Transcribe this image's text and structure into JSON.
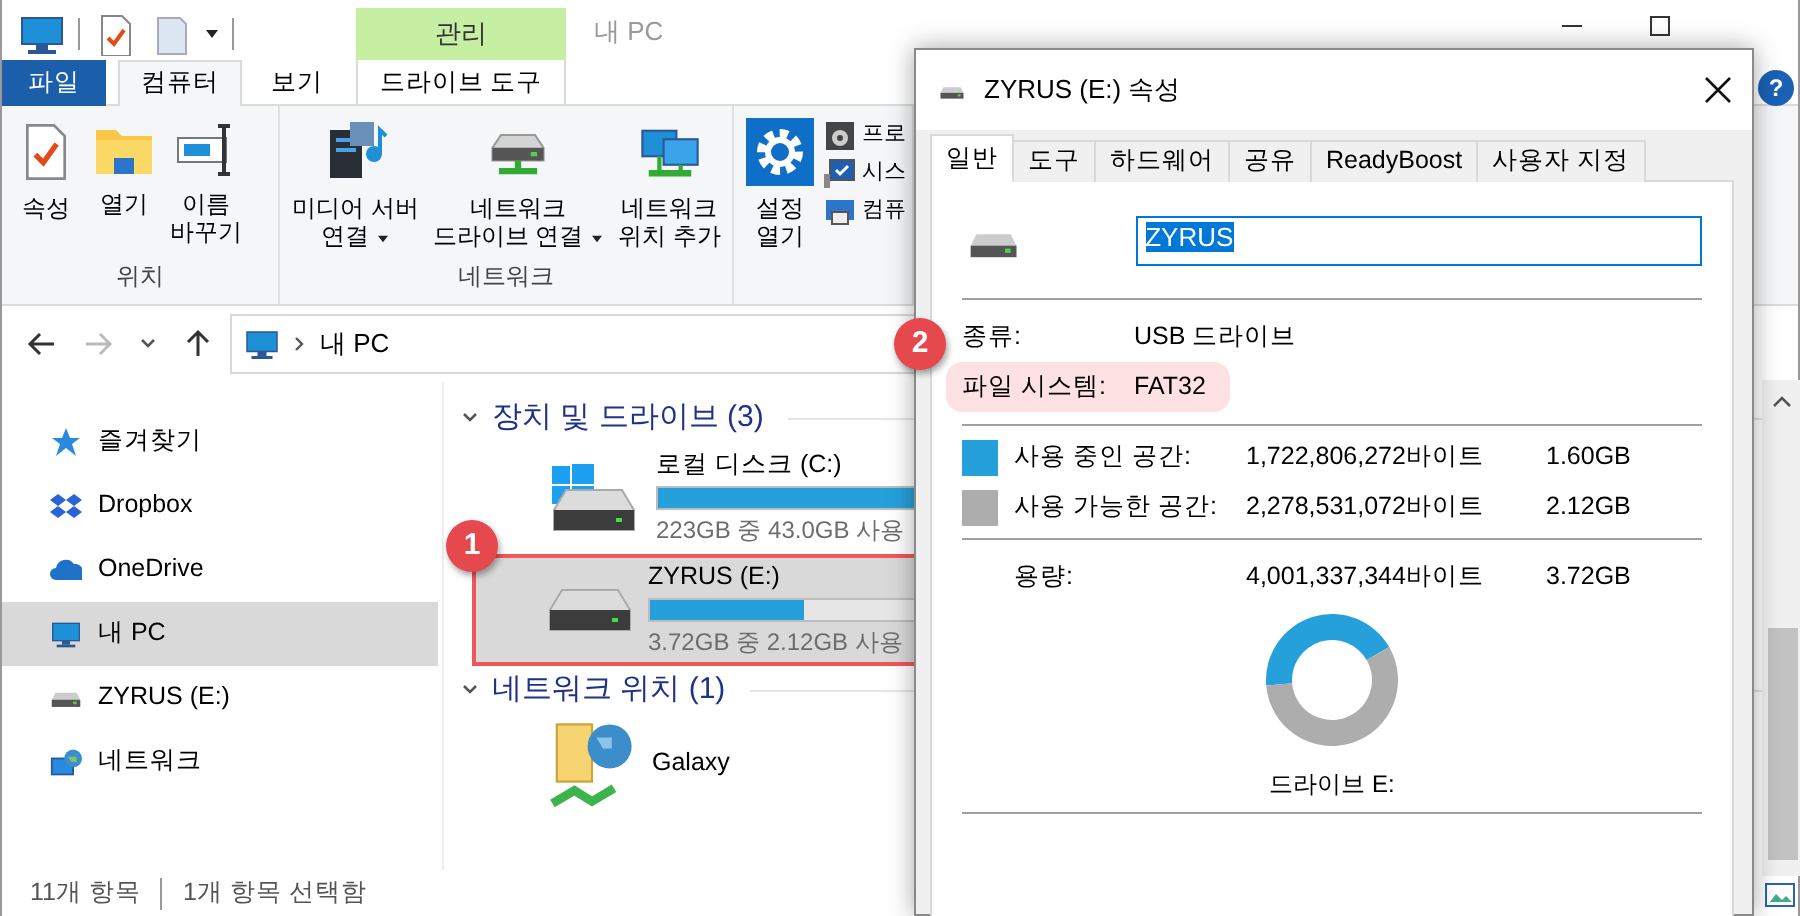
{
  "explorer": {
    "context_group": "관리",
    "title": "내 PC",
    "ribbon_tabs": [
      {
        "label": "파일",
        "kind": "file",
        "selected": false
      },
      {
        "label": "컴퓨터",
        "kind": "normal",
        "selected": true
      },
      {
        "label": "보기",
        "kind": "normal",
        "selected": false
      },
      {
        "label": "드라이브 도구",
        "kind": "contextual",
        "selected": false
      }
    ],
    "ribbon_groups": [
      {
        "label": "위치",
        "commands": [
          {
            "label": "속성",
            "kind": "properties"
          },
          {
            "label": "열기",
            "kind": "open"
          },
          {
            "label": "이름\n바꾸기",
            "kind": "rename"
          }
        ]
      },
      {
        "label": "네트워크",
        "commands": [
          {
            "label": "미디어 서버\n연결",
            "kind": "media",
            "has_menu": true
          },
          {
            "label": "네트워크\n드라이브 연결",
            "kind": "netdrive",
            "has_menu": true
          },
          {
            "label": "네트워크\n위치 추가",
            "kind": "netloc"
          }
        ]
      },
      {
        "commands": [
          {
            "label": "설정\n열기",
            "kind": "settings"
          },
          {
            "label": "프로",
            "kind": "programs"
          },
          {
            "label": "시스",
            "kind": "system"
          },
          {
            "label": "컴퓨",
            "kind": "manage"
          }
        ]
      }
    ],
    "address": {
      "path": "내 PC"
    },
    "nav_items": [
      {
        "label": "즐겨찾기",
        "kind": "favorites",
        "selected": false
      },
      {
        "label": "Dropbox",
        "kind": "dropbox",
        "selected": false
      },
      {
        "label": "OneDrive",
        "kind": "onedrive",
        "selected": false
      },
      {
        "label": "내 PC",
        "kind": "pc",
        "selected": true
      },
      {
        "label": "ZYRUS (E:)",
        "kind": "drive",
        "selected": false
      },
      {
        "label": "네트워크",
        "kind": "network",
        "selected": false
      }
    ],
    "content_groups": [
      {
        "title": "장치 및 드라이브 (3)",
        "expanded": true,
        "items": [
          {
            "name": "로컬 디스크 (C:)",
            "kind": "system-drive",
            "level": 0.81,
            "info": "223GB 중 43.0GB 사용",
            "selected": false,
            "highlighted": false
          },
          {
            "name": "ZYRUS (E:)",
            "kind": "drive",
            "level": 0.43,
            "info": "3.72GB 중 2.12GB 사용",
            "selected": true,
            "highlighted": true
          }
        ]
      },
      {
        "title": "네트워크 위치 (1)",
        "expanded": true,
        "items": [
          {
            "name": "Galaxy",
            "kind": "network-location"
          }
        ]
      }
    ],
    "status_bar": [
      "11개 항목",
      "1개 항목 선택함"
    ],
    "help": "?"
  },
  "dialog": {
    "title": "ZYRUS (E:) 속성",
    "tabs": [
      {
        "label": "일반",
        "selected": true
      },
      {
        "label": "도구",
        "selected": false
      },
      {
        "label": "하드웨어",
        "selected": false
      },
      {
        "label": "공유",
        "selected": false
      },
      {
        "label": "ReadyBoost",
        "selected": false
      },
      {
        "label": "사용자 지정",
        "selected": false
      }
    ],
    "name_field": {
      "value": "ZYRUS",
      "text_selected": true
    },
    "details": [
      {
        "label": "종류:",
        "value": "USB 드라이브",
        "highlighted": false
      },
      {
        "label": "파일 시스템:",
        "value": "FAT32",
        "highlighted": true
      }
    ],
    "space": [
      {
        "label": "사용 중인 공간:",
        "bytes": "1,722,806,272바이트",
        "size": "1.60GB",
        "color": "#26a0da"
      },
      {
        "label": "사용 가능한 공간:",
        "bytes": "2,278,531,072바이트",
        "size": "2.12GB",
        "color": "#adadad"
      }
    ],
    "capacity": {
      "label": "용량:",
      "bytes": "4,001,337,344바이트",
      "size": "3.72GB"
    },
    "chart_data": {
      "type": "donut",
      "values": [
        43,
        57
      ]
    },
    "drive_label": "드라이브 E:"
  },
  "annotations": [
    {
      "label": "1"
    },
    {
      "label": "2"
    }
  ]
}
